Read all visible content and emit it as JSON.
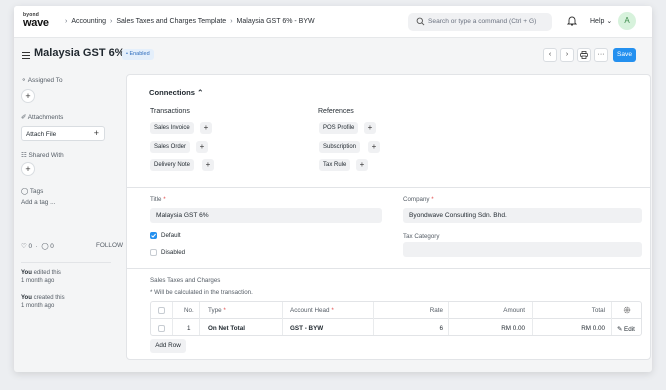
{
  "topbar": {
    "logo_line1": "byond",
    "logo_line2": "wave",
    "breadcrumbs": [
      "Accounting",
      "Sales Taxes and Charges Template",
      "Malaysia GST 6% - BYW"
    ],
    "search_placeholder": "Search or type a command (Ctrl + G)",
    "help_label": "Help",
    "avatar_initial": "A"
  },
  "header": {
    "title": "Malaysia GST 6%",
    "status_badge": "• Enabled",
    "more_label": "···",
    "save_label": "Save"
  },
  "sidebar": {
    "assigned_to_label": "Assigned To",
    "attachments_label": "Attachments",
    "attach_file_label": "Attach File",
    "shared_with_label": "Shared With",
    "tags_label": "Tags",
    "add_tag_label": "Add a tag ...",
    "likes_count": "0",
    "comments_count": "0",
    "follow_label": "FOLLOW",
    "activity": [
      {
        "actor": "You",
        "action": "edited this",
        "time": "1 month ago"
      },
      {
        "actor": "You",
        "action": "created this",
        "time": "1 month ago"
      }
    ]
  },
  "connections": {
    "title": "Connections",
    "transactions_heading": "Transactions",
    "references_heading": "References",
    "transactions": [
      "Sales Invoice",
      "Sales Order",
      "Delivery Note"
    ],
    "references": [
      "POS Profile",
      "Subscription",
      "Tax Rule"
    ]
  },
  "form": {
    "title_label": "Title",
    "title_value": "Malaysia GST 6%",
    "company_label": "Company",
    "company_value": "Byondwave Consulting Sdn. Bhd.",
    "default_label": "Default",
    "default_checked": true,
    "disabled_label": "Disabled",
    "disabled_checked": false,
    "tax_category_label": "Tax Category",
    "tax_category_value": ""
  },
  "taxes": {
    "section_label": "Sales Taxes and Charges",
    "note": "* Will be calculated in the transaction.",
    "columns": [
      "No.",
      "Type",
      "Account Head",
      "Rate",
      "Amount",
      "Total"
    ],
    "rows": [
      {
        "no": "1",
        "type": "On Net Total",
        "account_head": "GST - BYW",
        "rate": "6",
        "amount": "RM 0.00",
        "total": "RM 0.00"
      }
    ],
    "edit_label": "Edit",
    "add_row_label": "Add Row"
  },
  "colors": {
    "accent": "#2490ef",
    "badge_bg": "#e4effb",
    "badge_text": "#2f6dbd",
    "avatar_bg": "#d7f2dc",
    "required": "#e24c4c"
  }
}
